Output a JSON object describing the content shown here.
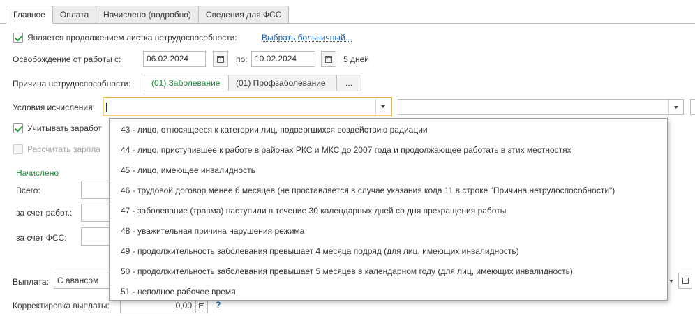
{
  "tabs": [
    {
      "label": "Главное",
      "active": true
    },
    {
      "label": "Оплата",
      "active": false
    },
    {
      "label": "Начислено (подробно)",
      "active": false
    },
    {
      "label": "Сведения для ФСС",
      "active": false
    }
  ],
  "continuation": {
    "checked": true,
    "label": "Является продолжением листка нетрудоспособности:",
    "link": "Выбрать больничный..."
  },
  "release": {
    "label": "Освобождение от работы с:",
    "from": "06.02.2024",
    "to_label": "по:",
    "to": "10.02.2024",
    "days": "5 дней"
  },
  "reason": {
    "label": "Причина нетрудоспособности:",
    "options": [
      "(01) Заболевание",
      "(01) Профзаболевание"
    ],
    "selected": 0,
    "more": "..."
  },
  "conditions": {
    "label": "Условия исчисления:",
    "value": "",
    "value2": ""
  },
  "account_salary": {
    "checked": true,
    "label": "Учитывать заработ"
  },
  "calc_salary": {
    "checked": false,
    "label": "Рассчитать зарпла"
  },
  "accrued": {
    "title": "Начислено",
    "total_label": "Всего:",
    "employer_label": "за счет работ.:",
    "fss_label": "за счет ФСС:"
  },
  "payment": {
    "label": "Выплата:",
    "value": "С авансом"
  },
  "correction": {
    "label": "Корректировка выплаты:",
    "value": "0,00",
    "help": "?"
  },
  "dropdown_items": [
    "43 - лицо, относящееся к категории лиц, подвергшихся воздействию радиации",
    "44 - лицо, приступившее к работе в районах РКС и МКС до 2007 года и продолжающее работать в этих местностях",
    "45 - лицо, имеющее инвалидность",
    "46 - трудовой договор менее 6 месяцев (не проставляется в случае указания кода 11 в строке \"Причина нетрудоспособности\")",
    "47 - заболевание (травма) наступили в течение 30 календарных дней со дня прекращения работы",
    "48 - уважительная причина нарушения режима",
    "49 - продолжительность заболевания превышает 4 месяца подряд (для лиц, имеющих инвалидность)",
    "50 - продолжительность заболевания превышает 5 месяцев в календарном году (для лиц, имеющих инвалидность)",
    "51 - неполное рабочее время"
  ],
  "colors": {
    "accent_green": "#1f8a3b",
    "link_blue": "#1d5fa7",
    "focus_yellow": "#e6b83a"
  }
}
